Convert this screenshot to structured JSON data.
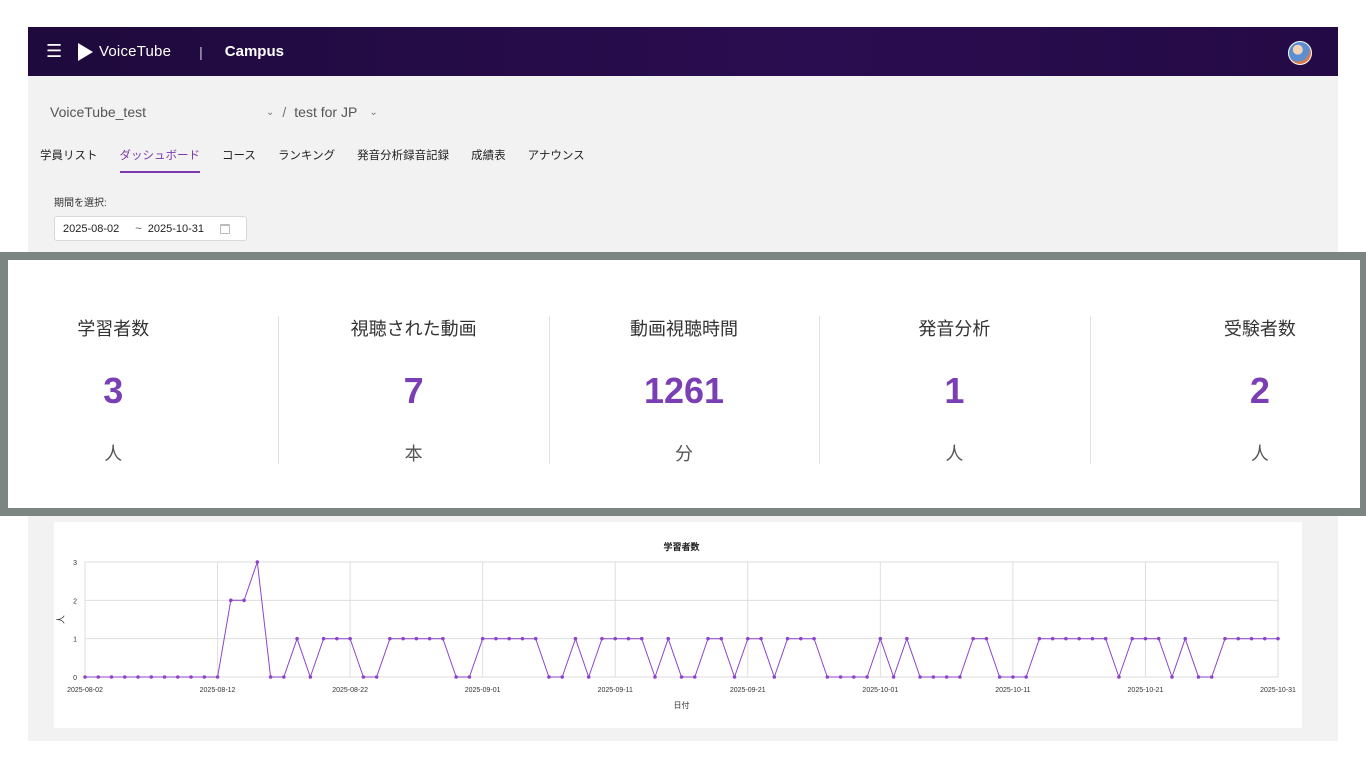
{
  "header": {
    "brand": "VoiceTube",
    "separator": "|",
    "product": "Campus",
    "menu_icon": "menu-icon",
    "avatar_icon": "user-avatar"
  },
  "breadcrumb": {
    "organization": "VoiceTube_test",
    "separator": "/",
    "course": "test for JP"
  },
  "tabs": [
    {
      "label": "学員リスト",
      "active": false
    },
    {
      "label": "ダッシュボード",
      "active": true
    },
    {
      "label": "コース",
      "active": false
    },
    {
      "label": "ランキング",
      "active": false
    },
    {
      "label": "発音分析録音記録",
      "active": false
    },
    {
      "label": "成績表",
      "active": false
    },
    {
      "label": "アナウンス",
      "active": false
    }
  ],
  "period": {
    "label": "期間を選択:",
    "start": "2025-08-02",
    "tilde": "~",
    "end": "2025-10-31"
  },
  "stats": [
    {
      "label": "学習者数",
      "value": "3",
      "unit": "人"
    },
    {
      "label": "視聴された動画",
      "value": "7",
      "unit": "本"
    },
    {
      "label": "動画視聴時間",
      "value": "1261",
      "unit": "分"
    },
    {
      "label": "発音分析",
      "value": "1",
      "unit": "人"
    },
    {
      "label": "受験者数",
      "value": "2",
      "unit": "人"
    }
  ],
  "colors": {
    "accent": "#7b3fb5",
    "header_bg": "#1e0a3c",
    "highlight_frame": "#7c8582",
    "series": "#8e44c9"
  },
  "chart_data": {
    "type": "line",
    "title": "学習者数",
    "xlabel": "日付",
    "ylabel": "人",
    "ylim": [
      0,
      3
    ],
    "yticks": [
      "0",
      "1",
      "2",
      "3"
    ],
    "xticks": [
      "2025-08-02",
      "2025-08-12",
      "2025-08-22",
      "2025-09-01",
      "2025-09-11",
      "2025-09-21",
      "2025-10-01",
      "2025-10-11",
      "2025-10-21",
      "2025-10-31"
    ],
    "grid": true,
    "x_start": "2025-08-02",
    "x_end": "2025-10-31",
    "series": [
      {
        "values": [
          0,
          0,
          0,
          0,
          0,
          0,
          0,
          0,
          0,
          0,
          0,
          2,
          2,
          3,
          0,
          0,
          1,
          0,
          1,
          1,
          1,
          0,
          0,
          1,
          1,
          1,
          1,
          1,
          0,
          0,
          1,
          1,
          1,
          1,
          1,
          0,
          0,
          1,
          0,
          1,
          1,
          1,
          1,
          0,
          1,
          0,
          0,
          1,
          1,
          0,
          1,
          1,
          0,
          1,
          1,
          1,
          0,
          0,
          0,
          0,
          1,
          0,
          1,
          0,
          0,
          0,
          0,
          1,
          1,
          0,
          0,
          0,
          1,
          1,
          1,
          1,
          1,
          1,
          0,
          1,
          1,
          1,
          0,
          1,
          0,
          0,
          1,
          1,
          1,
          1,
          1
        ]
      }
    ]
  }
}
